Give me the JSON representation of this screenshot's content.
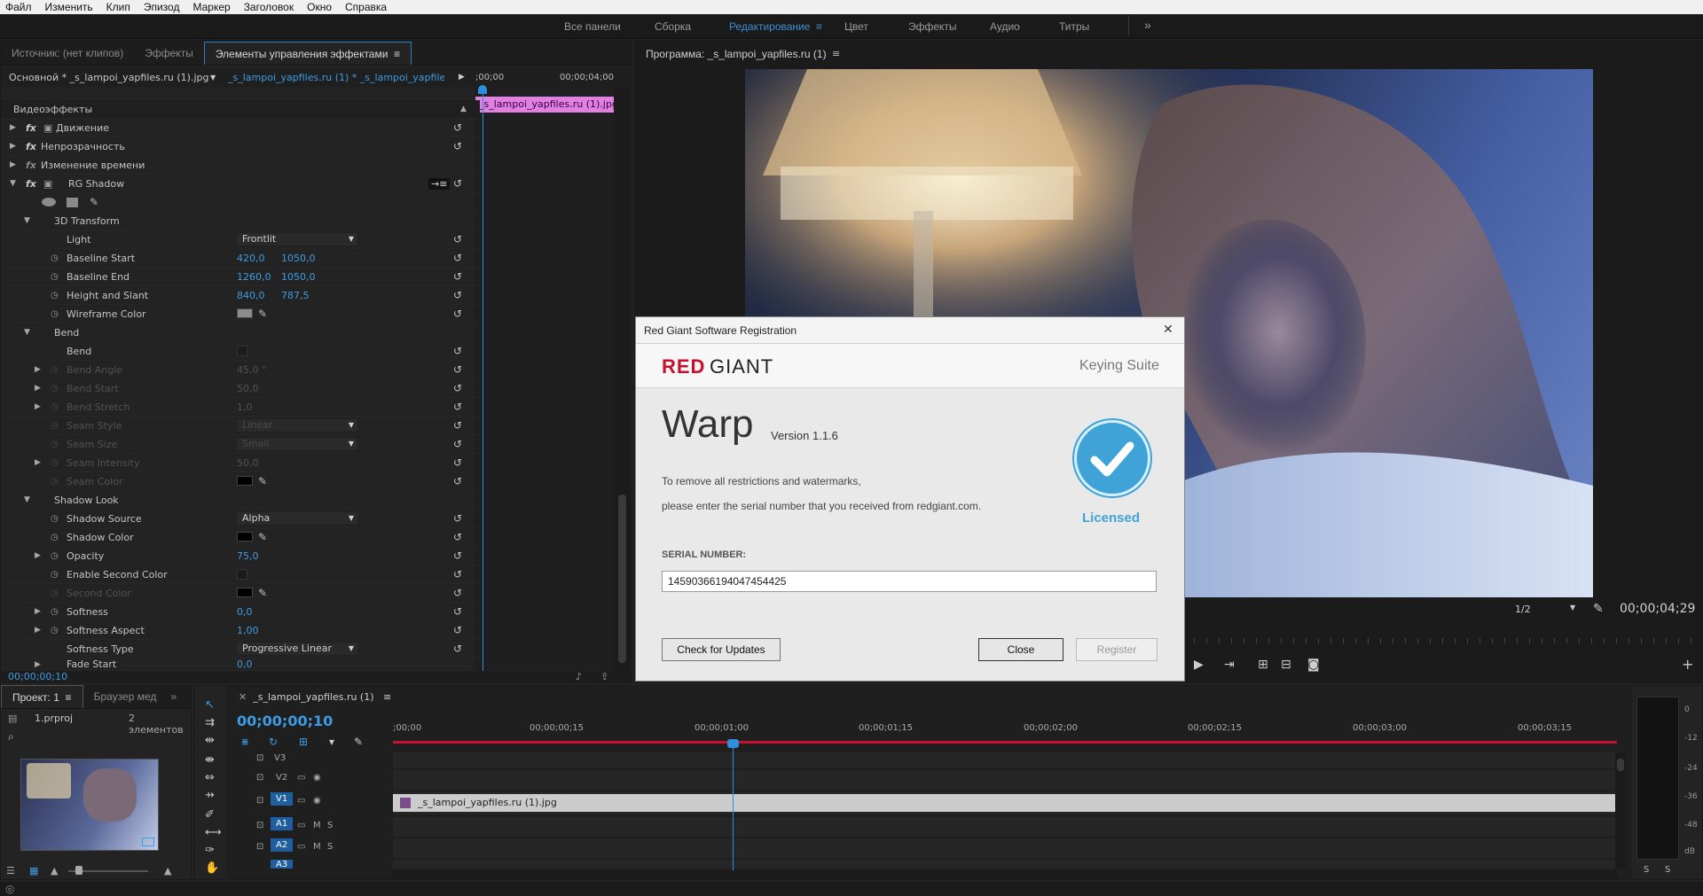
{
  "menu": [
    "Файл",
    "Изменить",
    "Клип",
    "Эпизод",
    "Маркер",
    "Заголовок",
    "Окно",
    "Справка"
  ],
  "workspaces": {
    "items": [
      "Все панели",
      "Сборка",
      "Редактирование",
      "Цвет",
      "Эффекты",
      "Аудио",
      "Титры"
    ],
    "active": "Редактирование",
    "overflow": "»"
  },
  "effect_panel": {
    "tabs": [
      "Источник: (нет клипов)",
      "Эффекты",
      "Элементы управления эффектами"
    ],
    "master_clip": "Основной * _s_lampoi_yapfiles.ru (1).jpg",
    "sequence_clip": "_s_lampoi_yapfiles.ru (1) * _s_lampoi_yapfile...",
    "timeline_start": ";00;00",
    "timeline_end": "00;00;04;00",
    "clip_label": "_s_lampoi_yapfiles.ru (1).jpg",
    "section_title": "Видеоэффекты",
    "fx_label": "fx",
    "effects": [
      "Движение",
      "Непрозрачность",
      "Изменение времени",
      "RG Shadow"
    ],
    "props": {
      "transform_group": "3D Transform",
      "light": {
        "label": "Light",
        "value": "Frontlit"
      },
      "baseline_start": {
        "label": "Baseline Start",
        "x": "420,0",
        "y": "1050,0"
      },
      "baseline_end": {
        "label": "Baseline End",
        "x": "1260,0",
        "y": "1050,0"
      },
      "height_slant": {
        "label": "Height and Slant",
        "x": "840,0",
        "y": "787,5"
      },
      "wireframe_color": {
        "label": "Wireframe Color",
        "color": "#8c8c8c"
      },
      "bend_group": "Bend",
      "bend": {
        "label": "Bend"
      },
      "bend_angle": {
        "label": "Bend Angle",
        "value": "45,0 °"
      },
      "bend_start": {
        "label": "Bend Start",
        "value": "50,0"
      },
      "bend_stretch": {
        "label": "Bend Stretch",
        "value": "1,0"
      },
      "seam_style": {
        "label": "Seam Style",
        "value": "Linear"
      },
      "seam_size": {
        "label": "Seam Size",
        "value": "Small"
      },
      "seam_intensity": {
        "label": "Seam Intensity",
        "value": "50,0"
      },
      "seam_color": {
        "label": "Seam Color",
        "color": "#000000"
      },
      "shadow_group": "Shadow Look",
      "shadow_source": {
        "label": "Shadow Source",
        "value": "Alpha"
      },
      "shadow_color": {
        "label": "Shadow Color",
        "color": "#000000"
      },
      "opacity": {
        "label": "Opacity",
        "value": "75,0"
      },
      "enable_second": {
        "label": "Enable Second Color"
      },
      "second_color": {
        "label": "Second Color",
        "color": "#000000"
      },
      "softness": {
        "label": "Softness",
        "value": "0,0"
      },
      "softness_aspect": {
        "label": "Softness Aspect",
        "value": "1,00"
      },
      "softness_type": {
        "label": "Softness Type",
        "value": "Progressive Linear"
      },
      "cutoff": {
        "label": "Fade Start",
        "value": "0,0"
      }
    },
    "timecode": "00;00;00;10"
  },
  "program": {
    "title": "Программа: _s_lampoi_yapfiles.ru (1)",
    "resolution": "1/2",
    "timecode": "00;00;04;29"
  },
  "dialog": {
    "title": "Red Giant Software Registration",
    "brand_red": "RED",
    "brand_rest": "GIANT",
    "suite": "Keying Suite",
    "product": "Warp",
    "version": "Version 1.1.6",
    "line1": "To remove all restrictions and watermarks,",
    "line2": "please enter the serial number that you received from redgiant.com.",
    "licensed": "Licensed",
    "serial_label": "SERIAL NUMBER:",
    "serial": "14590366194047454425",
    "check_updates": "Check for Updates",
    "close": "Close",
    "register": "Register",
    "close_glyph": "✕"
  },
  "project": {
    "tabs": [
      "Проект: 1",
      "Браузер мед"
    ],
    "file": "1.prproj",
    "count": "2 элементов"
  },
  "timeline": {
    "sequence": "_s_lampoi_yapfiles.ru (1)",
    "timecode": "00;00;00;10",
    "ruler": [
      ";00;00",
      "00;00;00;15",
      "00;00;01;00",
      "00;00;01;15",
      "00;00;02;00",
      "00;00;02;15",
      "00;00;03;00",
      "00;00;03;15"
    ],
    "tracks": {
      "v3": "V3",
      "v2": "V2",
      "v1": "V1",
      "a1": "A1",
      "a2": "A2",
      "a3": "A3"
    },
    "clip": "_s_lampoi_yapfiles.ru (1).jpg",
    "m": "M",
    "s": "S"
  },
  "meter": {
    "scale": [
      "0",
      "-12",
      "-24",
      "-36",
      "-48",
      "dB"
    ],
    "solo": [
      "S",
      "S"
    ]
  },
  "colors": {
    "accent": "#2d8fdc",
    "pink": "#e080e0",
    "red": "#c8102e",
    "clip": "#cccccc"
  }
}
